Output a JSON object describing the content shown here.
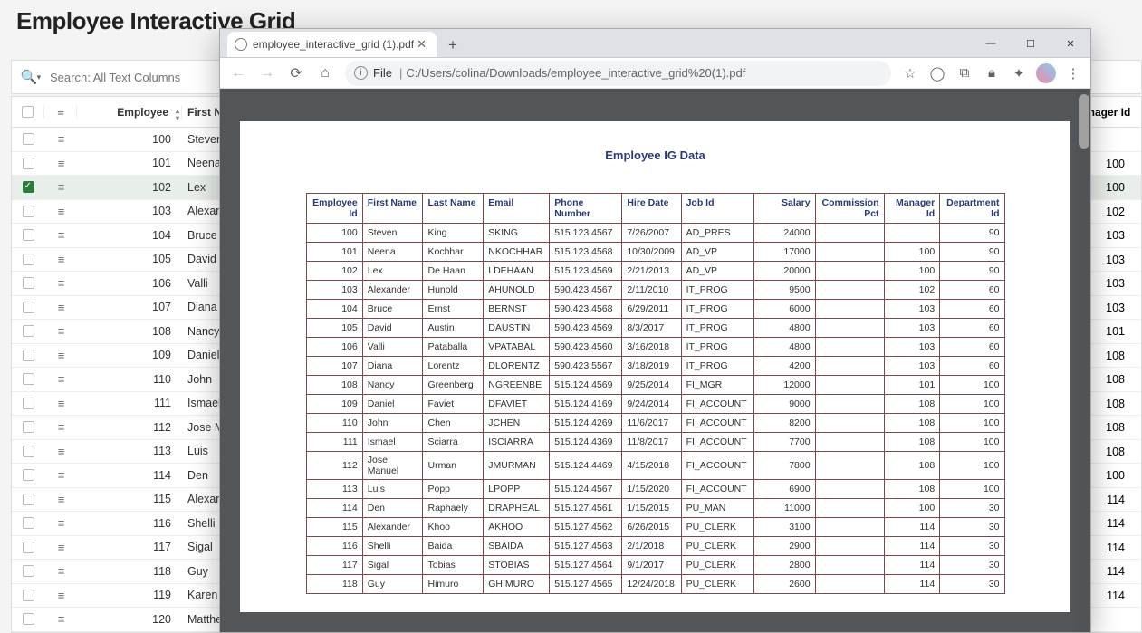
{
  "page_title": "Employee Interactive Grid",
  "search_placeholder": "Search: All Text Columns",
  "bg_headers": {
    "emp": "Employee",
    "first": "First Na",
    "mgr": "nager Id"
  },
  "bg_rows": [
    {
      "id": "100",
      "fn": "Steven",
      "mgr": "",
      "sel": false
    },
    {
      "id": "101",
      "fn": "Neena",
      "mgr": "100",
      "sel": false
    },
    {
      "id": "102",
      "fn": "Lex",
      "mgr": "100",
      "sel": true
    },
    {
      "id": "103",
      "fn": "Alexande",
      "mgr": "102",
      "sel": false
    },
    {
      "id": "104",
      "fn": "Bruce",
      "mgr": "103",
      "sel": false
    },
    {
      "id": "105",
      "fn": "David",
      "mgr": "103",
      "sel": false
    },
    {
      "id": "106",
      "fn": "Valli",
      "mgr": "103",
      "sel": false
    },
    {
      "id": "107",
      "fn": "Diana",
      "mgr": "103",
      "sel": false
    },
    {
      "id": "108",
      "fn": "Nancy",
      "mgr": "101",
      "sel": false
    },
    {
      "id": "109",
      "fn": "Daniel",
      "mgr": "108",
      "sel": false
    },
    {
      "id": "110",
      "fn": "John",
      "mgr": "108",
      "sel": false
    },
    {
      "id": "111",
      "fn": "Ismael",
      "mgr": "108",
      "sel": false
    },
    {
      "id": "112",
      "fn": "Jose Ma",
      "mgr": "108",
      "sel": false
    },
    {
      "id": "113",
      "fn": "Luis",
      "mgr": "108",
      "sel": false
    },
    {
      "id": "114",
      "fn": "Den",
      "mgr": "100",
      "sel": false
    },
    {
      "id": "115",
      "fn": "Alexand",
      "mgr": "114",
      "sel": false
    },
    {
      "id": "116",
      "fn": "Shelli",
      "mgr": "114",
      "sel": false
    },
    {
      "id": "117",
      "fn": "Sigal",
      "mgr": "114",
      "sel": false
    },
    {
      "id": "118",
      "fn": "Guy",
      "mgr": "114",
      "sel": false
    },
    {
      "id": "119",
      "fn": "Karen",
      "mgr": "114",
      "sel": false
    },
    {
      "id": "120",
      "fn": "Matthew",
      "mgr": "",
      "sel": false
    }
  ],
  "browser": {
    "tab_title": "employee_interactive_grid (1).pdf",
    "url_label": "File",
    "url_path": "C:/Users/colina/Downloads/employee_interactive_grid%20(1).pdf"
  },
  "pdf": {
    "title": "Employee IG Data",
    "headers": [
      "Employee Id",
      "First Name",
      "Last Name",
      "Email",
      "Phone Number",
      "Hire Date",
      "Job Id",
      "Salary",
      "Commission Pct",
      "Manager Id",
      "Department Id"
    ],
    "rows": [
      {
        "id": "100",
        "fn": "Steven",
        "ln": "King",
        "em": "SKING",
        "ph": "515.123.4567",
        "hd": "7/26/2007",
        "job": "AD_PRES",
        "sal": "24000",
        "com": "",
        "mgr": "",
        "dept": "90"
      },
      {
        "id": "101",
        "fn": "Neena",
        "ln": "Kochhar",
        "em": "NKOCHHAR",
        "ph": "515.123.4568",
        "hd": "10/30/2009",
        "job": "AD_VP",
        "sal": "17000",
        "com": "",
        "mgr": "100",
        "dept": "90"
      },
      {
        "id": "102",
        "fn": "Lex",
        "ln": "De Haan",
        "em": "LDEHAAN",
        "ph": "515.123.4569",
        "hd": "2/21/2013",
        "job": "AD_VP",
        "sal": "20000",
        "com": "",
        "mgr": "100",
        "dept": "90"
      },
      {
        "id": "103",
        "fn": "Alexander",
        "ln": "Hunold",
        "em": "AHUNOLD",
        "ph": "590.423.4567",
        "hd": "2/11/2010",
        "job": "IT_PROG",
        "sal": "9500",
        "com": "",
        "mgr": "102",
        "dept": "60"
      },
      {
        "id": "104",
        "fn": "Bruce",
        "ln": "Ernst",
        "em": "BERNST",
        "ph": "590.423.4568",
        "hd": "6/29/2011",
        "job": "IT_PROG",
        "sal": "6000",
        "com": "",
        "mgr": "103",
        "dept": "60"
      },
      {
        "id": "105",
        "fn": "David",
        "ln": "Austin",
        "em": "DAUSTIN",
        "ph": "590.423.4569",
        "hd": "8/3/2017",
        "job": "IT_PROG",
        "sal": "4800",
        "com": "",
        "mgr": "103",
        "dept": "60"
      },
      {
        "id": "106",
        "fn": "Valli",
        "ln": "Pataballa",
        "em": "VPATABAL",
        "ph": "590.423.4560",
        "hd": "3/16/2018",
        "job": "IT_PROG",
        "sal": "4800",
        "com": "",
        "mgr": "103",
        "dept": "60"
      },
      {
        "id": "107",
        "fn": "Diana",
        "ln": "Lorentz",
        "em": "DLORENTZ",
        "ph": "590.423.5567",
        "hd": "3/18/2019",
        "job": "IT_PROG",
        "sal": "4200",
        "com": "",
        "mgr": "103",
        "dept": "60"
      },
      {
        "id": "108",
        "fn": "Nancy",
        "ln": "Greenberg",
        "em": "NGREENBE",
        "ph": "515.124.4569",
        "hd": "9/25/2014",
        "job": "FI_MGR",
        "sal": "12000",
        "com": "",
        "mgr": "101",
        "dept": "100"
      },
      {
        "id": "109",
        "fn": "Daniel",
        "ln": "Faviet",
        "em": "DFAVIET",
        "ph": "515.124.4169",
        "hd": "9/24/2014",
        "job": "FI_ACCOUNT",
        "sal": "9000",
        "com": "",
        "mgr": "108",
        "dept": "100"
      },
      {
        "id": "110",
        "fn": "John",
        "ln": "Chen",
        "em": "JCHEN",
        "ph": "515.124.4269",
        "hd": "11/6/2017",
        "job": "FI_ACCOUNT",
        "sal": "8200",
        "com": "",
        "mgr": "108",
        "dept": "100"
      },
      {
        "id": "111",
        "fn": "Ismael",
        "ln": "Sciarra",
        "em": "ISCIARRA",
        "ph": "515.124.4369",
        "hd": "11/8/2017",
        "job": "FI_ACCOUNT",
        "sal": "7700",
        "com": "",
        "mgr": "108",
        "dept": "100"
      },
      {
        "id": "112",
        "fn": "Jose Manuel",
        "ln": "Urman",
        "em": "JMURMAN",
        "ph": "515.124.4469",
        "hd": "4/15/2018",
        "job": "FI_ACCOUNT",
        "sal": "7800",
        "com": "",
        "mgr": "108",
        "dept": "100"
      },
      {
        "id": "113",
        "fn": "Luis",
        "ln": "Popp",
        "em": "LPOPP",
        "ph": "515.124.4567",
        "hd": "1/15/2020",
        "job": "FI_ACCOUNT",
        "sal": "6900",
        "com": "",
        "mgr": "108",
        "dept": "100"
      },
      {
        "id": "114",
        "fn": "Den",
        "ln": "Raphaely",
        "em": "DRAPHEAL",
        "ph": "515.127.4561",
        "hd": "1/15/2015",
        "job": "PU_MAN",
        "sal": "11000",
        "com": "",
        "mgr": "100",
        "dept": "30"
      },
      {
        "id": "115",
        "fn": "Alexander",
        "ln": "Khoo",
        "em": "AKHOO",
        "ph": "515.127.4562",
        "hd": "6/26/2015",
        "job": "PU_CLERK",
        "sal": "3100",
        "com": "",
        "mgr": "114",
        "dept": "30"
      },
      {
        "id": "116",
        "fn": "Shelli",
        "ln": "Baida",
        "em": "SBAIDA",
        "ph": "515.127.4563",
        "hd": "2/1/2018",
        "job": "PU_CLERK",
        "sal": "2900",
        "com": "",
        "mgr": "114",
        "dept": "30"
      },
      {
        "id": "117",
        "fn": "Sigal",
        "ln": "Tobias",
        "em": "STOBIAS",
        "ph": "515.127.4564",
        "hd": "9/1/2017",
        "job": "PU_CLERK",
        "sal": "2800",
        "com": "",
        "mgr": "114",
        "dept": "30"
      },
      {
        "id": "118",
        "fn": "Guy",
        "ln": "Himuro",
        "em": "GHIMURO",
        "ph": "515.127.4565",
        "hd": "12/24/2018",
        "job": "PU_CLERK",
        "sal": "2600",
        "com": "",
        "mgr": "114",
        "dept": "30"
      }
    ]
  }
}
